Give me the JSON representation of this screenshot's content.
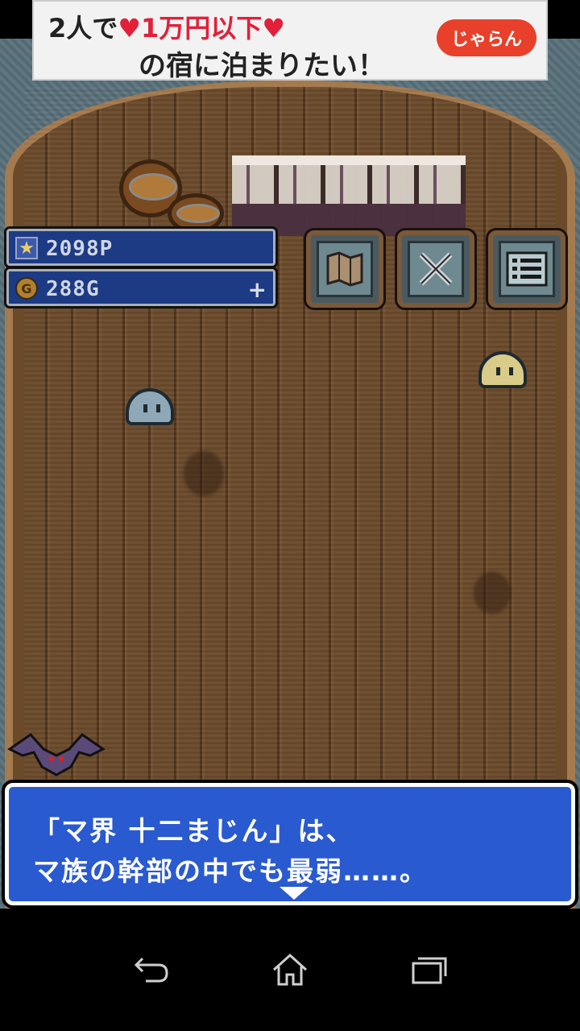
{
  "ad": {
    "line1_prefix": "2人で",
    "line1_highlight": "♥1万円以下♥",
    "line2": "の宿に泊まりたい！",
    "brand": "じゃらん"
  },
  "hud": {
    "points": "2098P",
    "gold": "288G",
    "gold_add": "+",
    "points_icon": "star-icon",
    "gold_icon": "coin-icon"
  },
  "menu": {
    "map_icon": "map-icon",
    "battle_icon": "crossed-swords-icon",
    "list_icon": "list-icon"
  },
  "dialog": {
    "line1": "「マ界 十二まじん」は、",
    "line2": "マ族の幹部の中でも最弱……。"
  },
  "colors": {
    "dialog_bg": "#2a5ad0",
    "hud_bg": "#1d3a84",
    "deck": "#6a4a2b"
  }
}
